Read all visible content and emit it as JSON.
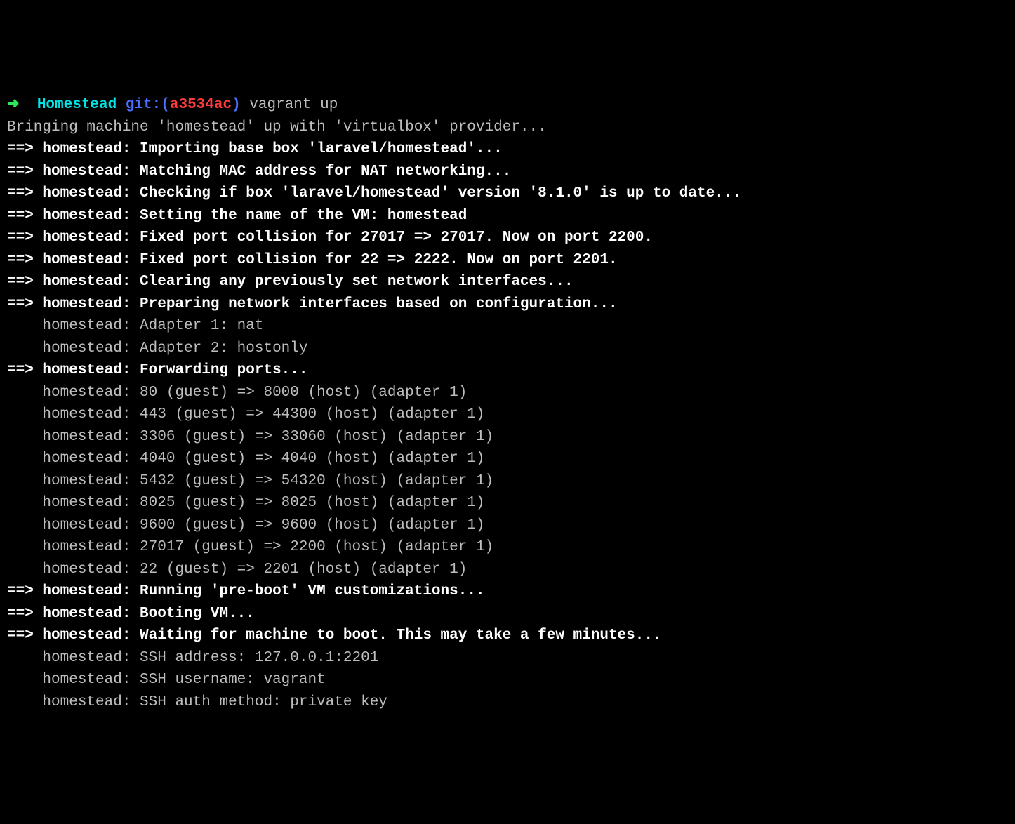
{
  "prompt": {
    "arrow": "➜",
    "dir": "Homestead",
    "git_label": "git:(",
    "git_ref": "a3534ac",
    "git_close": ")",
    "command": "vagrant up"
  },
  "lines": [
    {
      "type": "plain",
      "text": "Bringing machine 'homestead' up with 'virtualbox' provider..."
    },
    {
      "type": "arrow",
      "prefix": "==>",
      "label": "homestead:",
      "msg": "Importing base box 'laravel/homestead'..."
    },
    {
      "type": "arrow",
      "prefix": "==>",
      "label": "homestead:",
      "msg": "Matching MAC address for NAT networking..."
    },
    {
      "type": "arrow",
      "prefix": "==>",
      "label": "homestead:",
      "msg": "Checking if box 'laravel/homestead' version '8.1.0' is up to date..."
    },
    {
      "type": "arrow",
      "prefix": "==>",
      "label": "homestead:",
      "msg": "Setting the name of the VM: homestead"
    },
    {
      "type": "arrow",
      "prefix": "==>",
      "label": "homestead:",
      "msg": "Fixed port collision for 27017 => 27017. Now on port 2200."
    },
    {
      "type": "arrow",
      "prefix": "==>",
      "label": "homestead:",
      "msg": "Fixed port collision for 22 => 2222. Now on port 2201."
    },
    {
      "type": "arrow",
      "prefix": "==>",
      "label": "homestead:",
      "msg": "Clearing any previously set network interfaces..."
    },
    {
      "type": "arrow",
      "prefix": "==>",
      "label": "homestead:",
      "msg": "Preparing network interfaces based on configuration..."
    },
    {
      "type": "sub",
      "label": "homestead:",
      "msg": "Adapter 1: nat"
    },
    {
      "type": "sub",
      "label": "homestead:",
      "msg": "Adapter 2: hostonly"
    },
    {
      "type": "arrow",
      "prefix": "==>",
      "label": "homestead:",
      "msg": "Forwarding ports..."
    },
    {
      "type": "sub",
      "label": "homestead:",
      "msg": "80 (guest) => 8000 (host) (adapter 1)"
    },
    {
      "type": "sub",
      "label": "homestead:",
      "msg": "443 (guest) => 44300 (host) (adapter 1)"
    },
    {
      "type": "sub",
      "label": "homestead:",
      "msg": "3306 (guest) => 33060 (host) (adapter 1)"
    },
    {
      "type": "sub",
      "label": "homestead:",
      "msg": "4040 (guest) => 4040 (host) (adapter 1)"
    },
    {
      "type": "sub",
      "label": "homestead:",
      "msg": "5432 (guest) => 54320 (host) (adapter 1)"
    },
    {
      "type": "sub",
      "label": "homestead:",
      "msg": "8025 (guest) => 8025 (host) (adapter 1)"
    },
    {
      "type": "sub",
      "label": "homestead:",
      "msg": "9600 (guest) => 9600 (host) (adapter 1)"
    },
    {
      "type": "sub",
      "label": "homestead:",
      "msg": "27017 (guest) => 2200 (host) (adapter 1)"
    },
    {
      "type": "sub",
      "label": "homestead:",
      "msg": "22 (guest) => 2201 (host) (adapter 1)"
    },
    {
      "type": "arrow",
      "prefix": "==>",
      "label": "homestead:",
      "msg": "Running 'pre-boot' VM customizations..."
    },
    {
      "type": "arrow",
      "prefix": "==>",
      "label": "homestead:",
      "msg": "Booting VM..."
    },
    {
      "type": "arrow",
      "prefix": "==>",
      "label": "homestead:",
      "msg": "Waiting for machine to boot. This may take a few minutes..."
    },
    {
      "type": "sub",
      "label": "homestead:",
      "msg": "SSH address: 127.0.0.1:2201"
    },
    {
      "type": "sub",
      "label": "homestead:",
      "msg": "SSH username: vagrant"
    },
    {
      "type": "sub",
      "label": "homestead:",
      "msg": "SSH auth method: private key"
    }
  ]
}
